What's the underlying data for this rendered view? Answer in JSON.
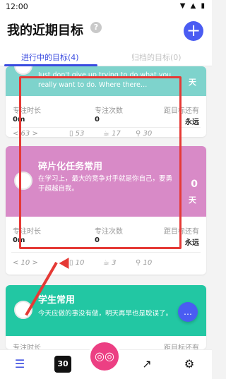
{
  "statusbar": {
    "time": "12:00",
    "icons": "▼ ▲ ▮"
  },
  "header": {
    "title": "我的近期目标",
    "help": "?",
    "add": "+"
  },
  "tabs": {
    "active": "进行中的目标(4)",
    "inactive": "归档的目标(0)"
  },
  "cards": [
    {
      "name": "",
      "motto": "Just don't give up trying to do what you really want to do. Where there…",
      "days_value": "",
      "days_unit": "天",
      "color": "#7ed3cc",
      "stat_labels": [
        "专注时长",
        "专注次数",
        "距目标还有"
      ],
      "stat_values": [
        "0m",
        "0",
        "永远"
      ],
      "metrics": [
        "< 63 >",
        "▯ 53",
        "☕ 17",
        "⚲ 30"
      ]
    },
    {
      "name": "碎片化任务常用",
      "motto": "在学习上，最大的竞争对手就是你自己，要勇于超越自我。",
      "days_value": "0",
      "days_unit": "天",
      "color": "#d88ac7",
      "stat_labels": [
        "专注时长",
        "专注次数",
        "距目标还有"
      ],
      "stat_values": [
        "0m",
        "0",
        "永远"
      ],
      "metrics": [
        "< 10 >",
        "▯ 10",
        "☕ 3",
        "⚲ 10"
      ]
    },
    {
      "name": "学生常用",
      "motto": "今天应做的事没有做，明天再早也是耽误了。",
      "days_value": "",
      "days_unit": "",
      "color": "#22c7a3",
      "stat_labels": [
        "专注时长",
        "",
        "距目标还有"
      ],
      "stat_values": [
        "",
        "",
        ""
      ],
      "metrics": []
    }
  ],
  "bottom_nav": {
    "items": [
      {
        "name": "list-icon",
        "glyph": "☰"
      },
      {
        "name": "calendar-30-icon",
        "glyph": "30"
      },
      {
        "name": "focus-robot-icon",
        "glyph": "◎◎"
      },
      {
        "name": "stats-icon",
        "glyph": "↗"
      },
      {
        "name": "settings-gear-icon",
        "glyph": "⚙"
      }
    ]
  },
  "fab": {
    "glyph": "…"
  }
}
